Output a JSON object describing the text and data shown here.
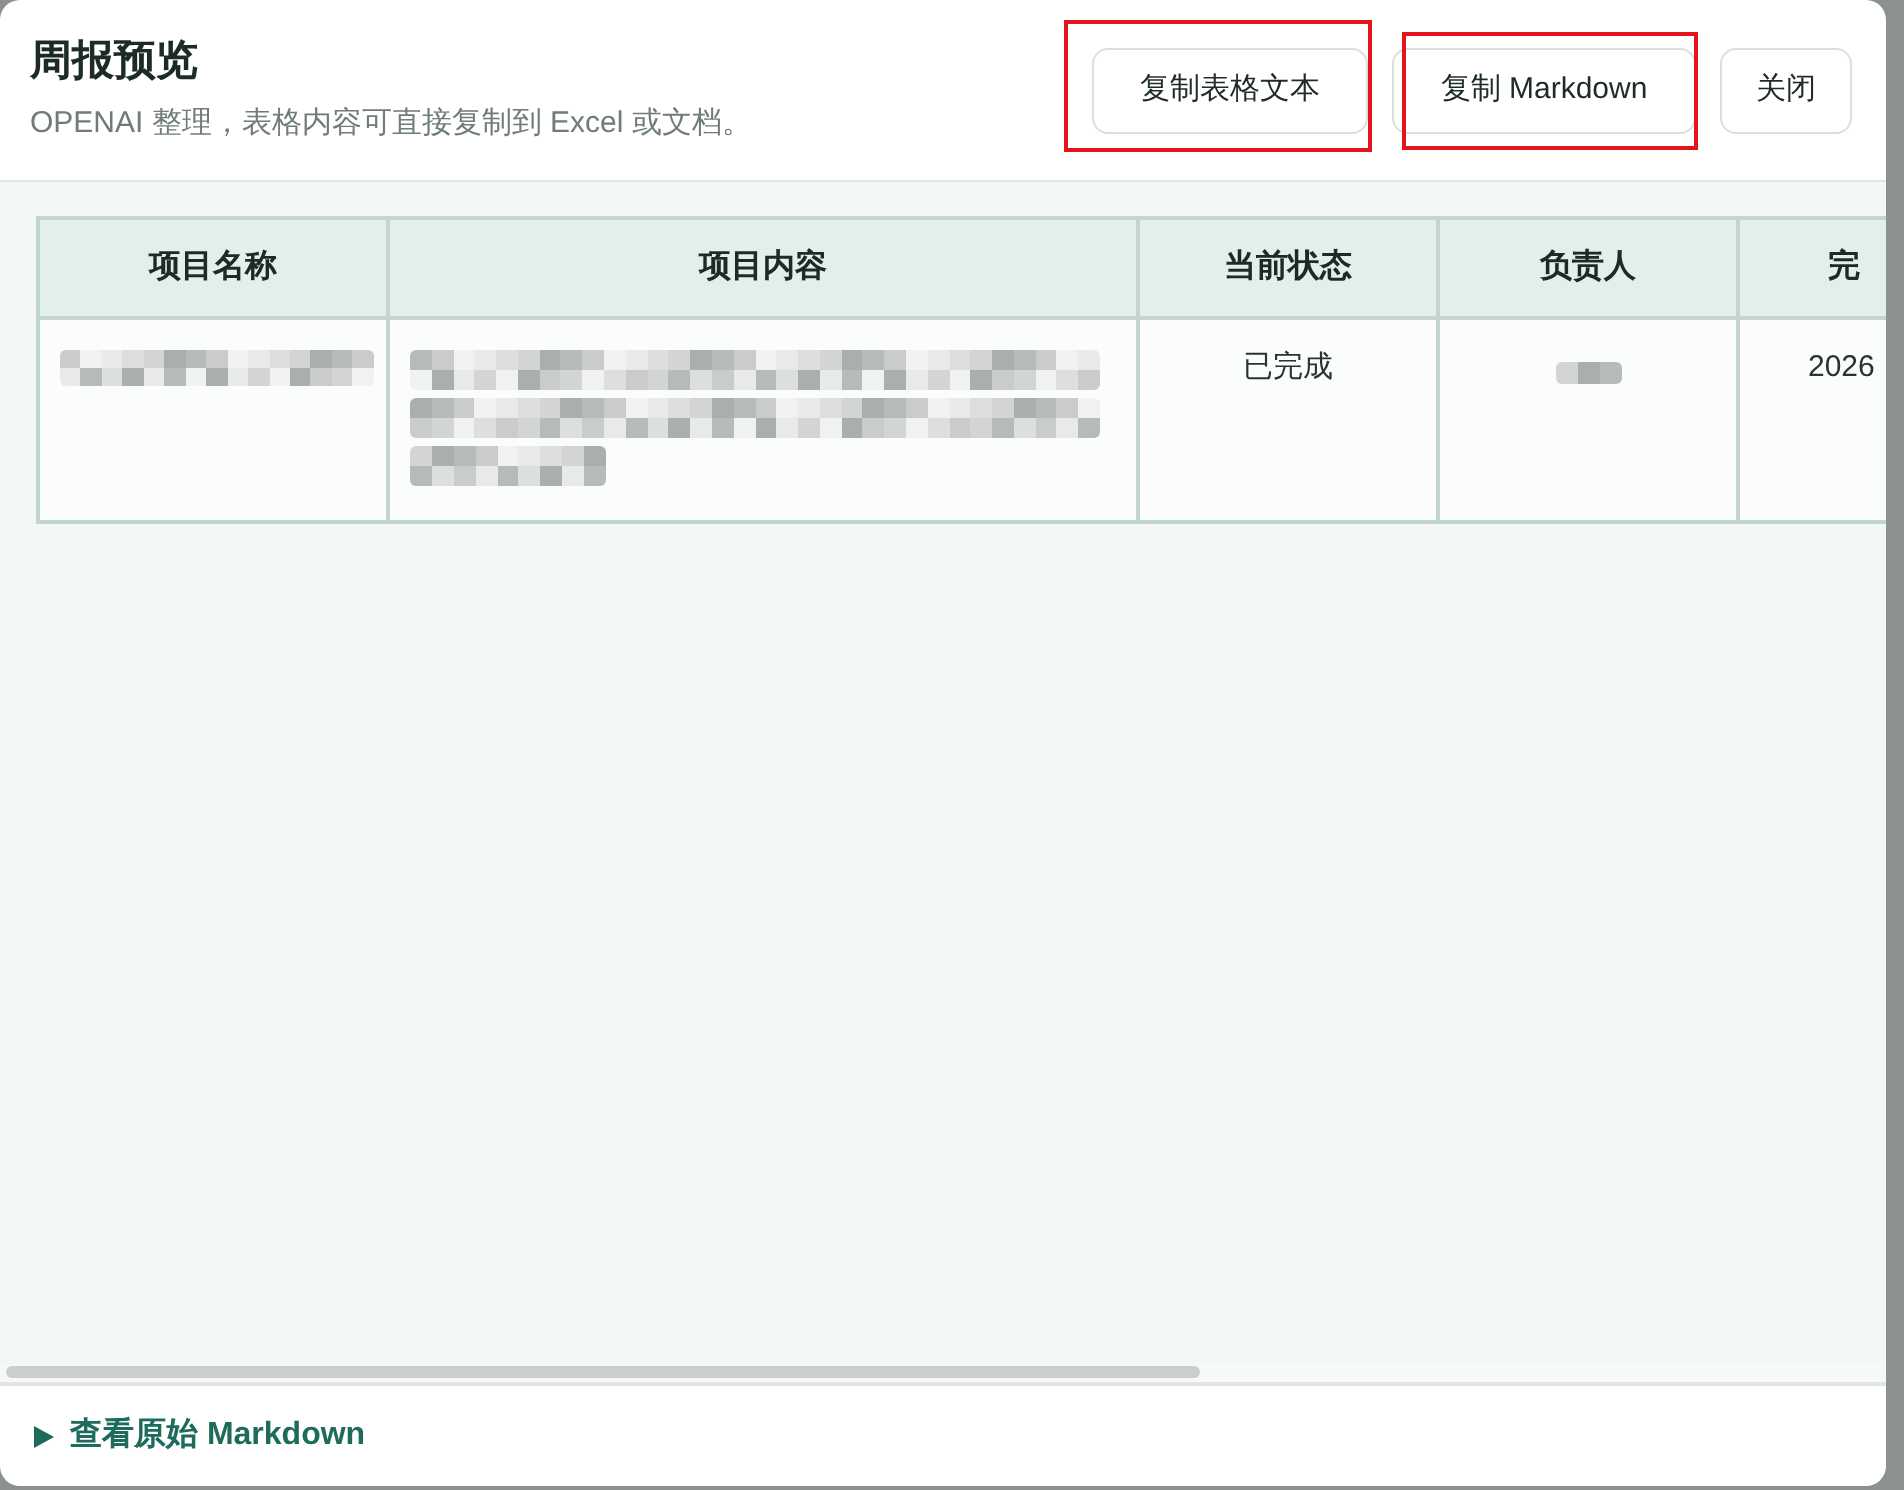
{
  "dialog": {
    "title": "周报预览",
    "subtitle": "OPENAI 整理，表格内容可直接复制到 Excel 或文档。",
    "buttons": [
      {
        "label": "复制表格文本",
        "highlighted": true
      },
      {
        "label": "复制 Markdown",
        "highlighted": true
      },
      {
        "label": "关闭",
        "highlighted": false
      }
    ]
  },
  "table": {
    "columns": [
      "项目名称",
      "项目内容",
      "当前状态",
      "负责人",
      "完"
    ],
    "rows": [
      {
        "cells": [
          {
            "kind": "blurline"
          },
          {
            "kind": "blurparagraph"
          },
          {
            "kind": "text",
            "text": "已完成"
          },
          {
            "kind": "blurshort"
          },
          {
            "kind": "text",
            "text": "2026"
          }
        ]
      }
    ]
  },
  "footer": {
    "toggle": {
      "label": "查看原始 Markdown",
      "expanded": false
    }
  }
}
